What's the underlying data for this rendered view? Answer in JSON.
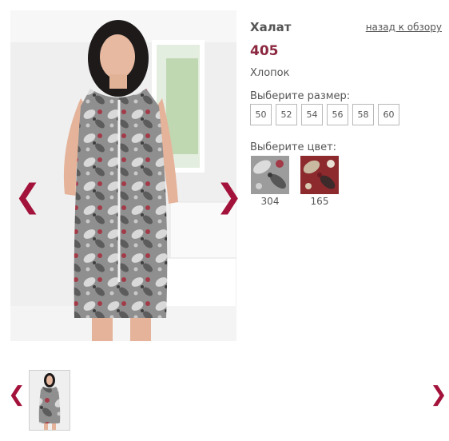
{
  "product": {
    "title": "Халат",
    "price": "405",
    "material": "Хлопок",
    "back_link": "назад к обзору"
  },
  "size_selector": {
    "label": "Выберите размер:",
    "options": [
      "50",
      "52",
      "54",
      "56",
      "58",
      "60"
    ]
  },
  "color_selector": {
    "label": "Выберите цвет:",
    "options": [
      {
        "code": "304",
        "base": "#9c9c9c"
      },
      {
        "code": "165",
        "base": "#8c2a2e"
      }
    ]
  },
  "gallery": {
    "prev_symbol": "❮",
    "next_symbol": "❯"
  },
  "colors": {
    "accent": "#a3123a",
    "price": "#8b2840",
    "text": "#555555",
    "border": "#b9b9b9"
  }
}
